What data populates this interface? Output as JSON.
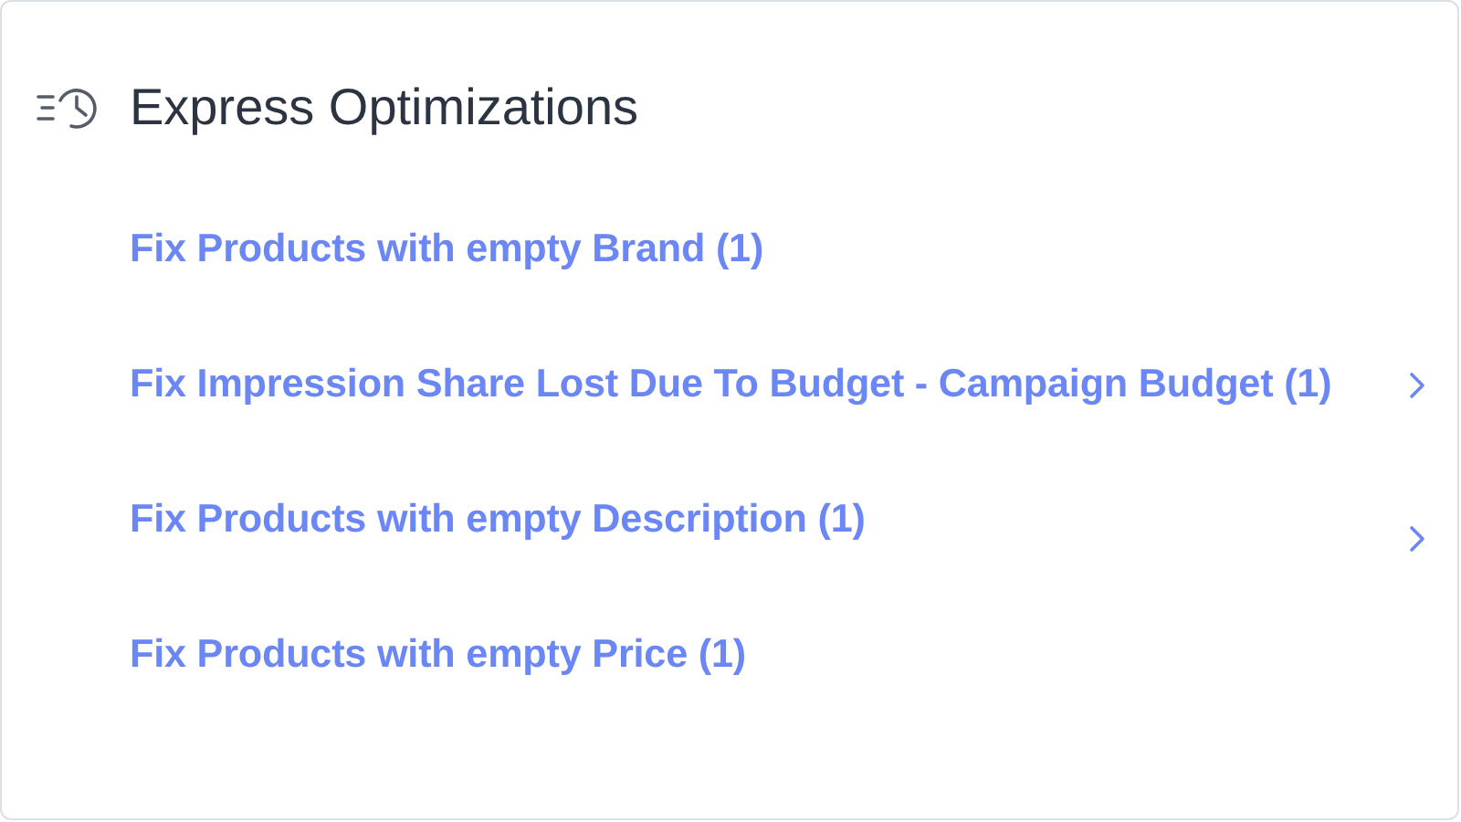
{
  "header": {
    "title": "Express Optimizations"
  },
  "items": [
    {
      "label": "Fix Products with empty Brand (1)",
      "expandable": false
    },
    {
      "label": "Fix Impression Share Lost Due To Budget - Campaign Budget (1)",
      "expandable": true
    },
    {
      "label": "Fix Products with empty Description (1)",
      "expandable": true
    },
    {
      "label": "Fix Products with empty Price (1)",
      "expandable": false
    }
  ]
}
